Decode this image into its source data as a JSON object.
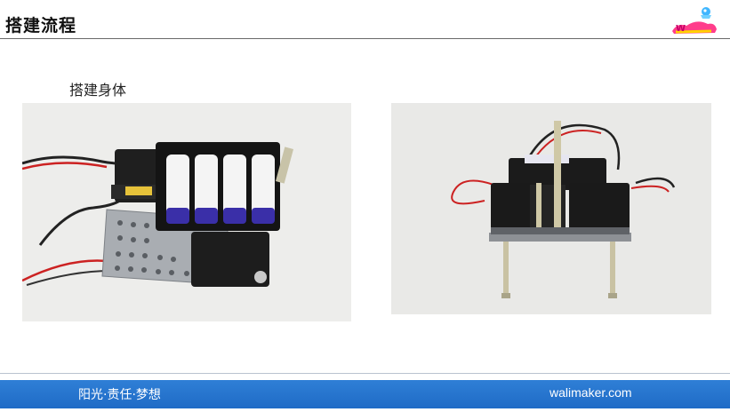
{
  "header": {
    "title": "搭建流程"
  },
  "logo": {
    "icon": "walimaker-logo-icon"
  },
  "section": {
    "heading": "搭建身体"
  },
  "photos": [
    {
      "name": "assembled-body-top-view",
      "icon": "robot-photo-icon"
    },
    {
      "name": "assembled-body-front-view",
      "icon": "robot-photo-icon"
    }
  ],
  "footer": {
    "motto": "阳光·责任·梦想",
    "site": "walimaker.com"
  },
  "colors": {
    "footer_bar": "#2a78d0",
    "rule": "#6a6a6a"
  }
}
